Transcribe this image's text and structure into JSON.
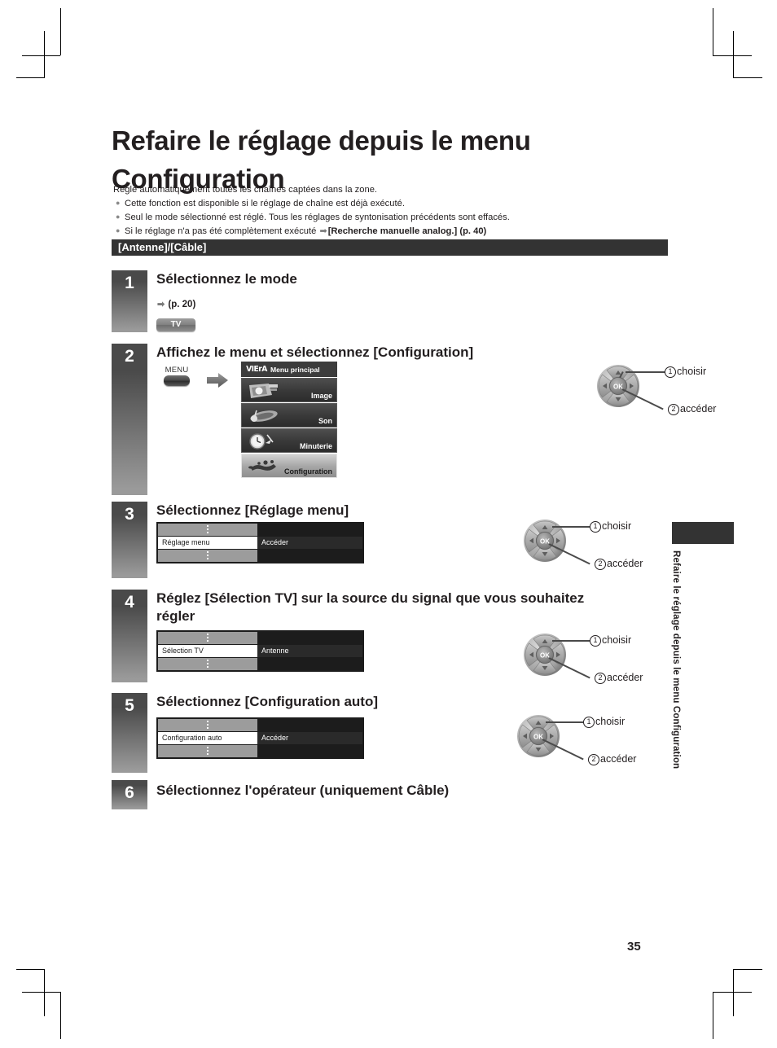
{
  "page": {
    "number": "35",
    "side_tab_label": "Refaire le réglage depuis le menu Configuration"
  },
  "title": "Refaire le réglage depuis le menu Configuration",
  "intro": {
    "lead": "Règle automatiquement toutes les chaînes captées dans la zone.",
    "bullets": [
      {
        "text": "Cette fonction est disponible si le réglage de chaîne est déjà exécuté.",
        "ref_bold": "",
        "ref_tail": ""
      },
      {
        "text": "Seul le mode sélectionné est réglé. Tous les réglages de syntonisation précédents sont effacés.",
        "ref_bold": "",
        "ref_tail": ""
      },
      {
        "text": "Si le réglage n'a pas été complètement exécuté ",
        "ref_bold": "[Recherche manuelle analog.]",
        "ref_tail": " (p. 40)"
      }
    ]
  },
  "section_bar": "[Antenne]/[Câble]",
  "steps": [
    {
      "num": "1",
      "title": "Sélectionnez le mode",
      "page_ref": "(p. 20)",
      "key_label": "TV"
    },
    {
      "num": "2",
      "title": "Affichez le menu et sélectionnez [Configuration]",
      "remote_key": "MENU",
      "viera": {
        "logo": "VIErA",
        "header": "Menu principal",
        "items": [
          {
            "label": "Image",
            "icon": "picture-icon",
            "selected": false
          },
          {
            "label": "Son",
            "icon": "sound-icon",
            "selected": false
          },
          {
            "label": "Minuterie",
            "icon": "clock-icon",
            "selected": false
          },
          {
            "label": "Configuration",
            "icon": "wrench-icon",
            "selected": true
          }
        ]
      },
      "callouts": {
        "one": "choisir",
        "two": "accéder",
        "n1": "1",
        "n2": "2"
      }
    },
    {
      "num": "3",
      "title": "Sélectionnez [Réglage menu]",
      "table": {
        "label": "Réglage menu",
        "value": "Accéder"
      },
      "callouts": {
        "one": "choisir",
        "two": "accéder",
        "n1": "1",
        "n2": "2"
      }
    },
    {
      "num": "4",
      "title": "Réglez [Sélection TV] sur la source du signal que vous souhaitez régler",
      "table": {
        "label": "Sélection TV",
        "value": "Antenne"
      },
      "callouts": {
        "one": "choisir",
        "two": "accéder",
        "n1": "1",
        "n2": "2"
      }
    },
    {
      "num": "5",
      "title": "Sélectionnez [Configuration auto]",
      "table": {
        "label": "Configuration auto",
        "value": "Accéder"
      },
      "callouts": {
        "one": "choisir",
        "two": "accéder",
        "n1": "1",
        "n2": "2"
      }
    },
    {
      "num": "6",
      "title": "Sélectionnez l'opérateur (uniquement Câble)"
    }
  ],
  "colors": {
    "ink": "#231f20",
    "bar": "#333333",
    "panel_dark": "#1c1c1c",
    "panel_gray": "#9c9c9c"
  }
}
